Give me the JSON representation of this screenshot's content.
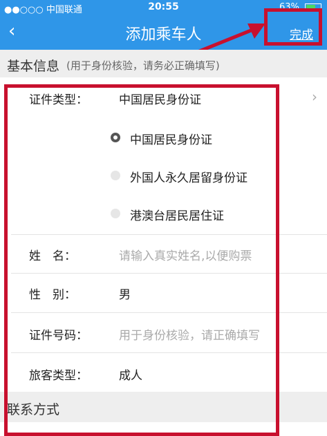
{
  "status_bar": {
    "carrier": "●●○○○ 中国联通",
    "time": "20:55",
    "battery": "63%"
  },
  "nav": {
    "title": "添加乘车人",
    "done_label": "完成"
  },
  "basic_section": {
    "title": "基本信息",
    "subtitle": "(用于身份核验，请务必正确填写)"
  },
  "form": {
    "id_type": {
      "label": "证件类型：",
      "value": "中国居民身份证"
    },
    "id_options": [
      {
        "label": "中国居民身份证",
        "selected": true
      },
      {
        "label": "外国人永久居留身份证",
        "selected": false
      },
      {
        "label": "港澳台居民居住证",
        "selected": false
      }
    ],
    "name": {
      "label": "姓　名：",
      "placeholder": "请输入真实姓名,以便购票"
    },
    "gender": {
      "label": "性　别：",
      "value": "男"
    },
    "id_number": {
      "label": "证件号码：",
      "placeholder": "用于身份核验，请正确填写"
    },
    "passenger_type": {
      "label": "旅客类型：",
      "value": "成人"
    }
  },
  "contact_section": {
    "title": "联系方式"
  },
  "colors": {
    "nav_blue": "#2f96e8",
    "highlight_red": "#c8102e"
  }
}
